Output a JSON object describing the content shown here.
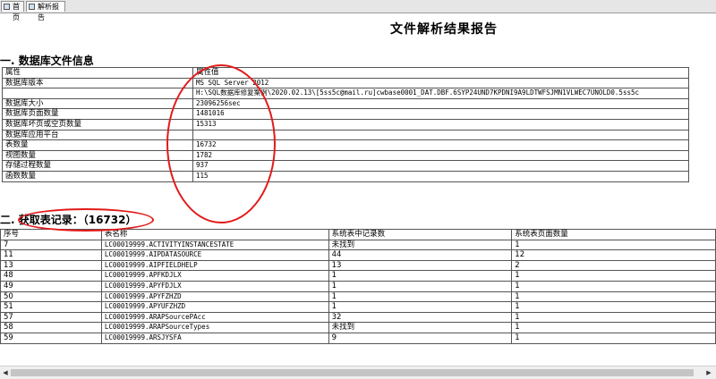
{
  "tabs": [
    {
      "label": "首页",
      "icon": "home-icon"
    },
    {
      "label": "解析报告",
      "icon": "report-icon"
    }
  ],
  "report_title": "文件解析结果报告",
  "section1": {
    "title": "一. 数据库文件信息",
    "header": [
      "属性",
      "属性值"
    ],
    "rows": [
      [
        "数据库版本",
        "MS SQL Server 2012"
      ],
      [
        "",
        "H:\\SQL数据库修复案例\\2020.02.13\\[5ss5c@mail.ru]cwbase0001_DAT.DBF.6SYP24UND7KPDNI9A9LDTWFSJMN1VLWEC7UNOLD0.5ss5c"
      ],
      [
        "数据库大小",
        "23096256sec"
      ],
      [
        "数据库页面数量",
        "1481016"
      ],
      [
        "数据库坏页或空页数量",
        "15313"
      ],
      [
        "数据库应用平台",
        ""
      ],
      [
        "表数量",
        "16732"
      ],
      [
        "视图数量",
        "1782"
      ],
      [
        "存储过程数量",
        "937"
      ],
      [
        "函数数量",
        "115"
      ]
    ]
  },
  "section2": {
    "title": "二. 获取表记录：（16732）",
    "header": [
      "序号",
      "表名称",
      "系统表中记录数",
      "系统表页面数量"
    ],
    "rows": [
      [
        "7",
        "LC00019999.ACTIVITYINSTANCESTATE",
        "未找到",
        "1"
      ],
      [
        "11",
        "LC00019999.AIPDATASOURCE",
        "44",
        "12"
      ],
      [
        "13",
        "LC00019999.AIPFIELDHELP",
        "13",
        "2"
      ],
      [
        "48",
        "LC00019999.APFKDJLX",
        "1",
        "1"
      ],
      [
        "49",
        "LC00019999.APYFDJLX",
        "1",
        "1"
      ],
      [
        "50",
        "LC00019999.APYFZHZD",
        "1",
        "1"
      ],
      [
        "51",
        "LC00019999.APYUFZHZD",
        "1",
        "1"
      ],
      [
        "57",
        "LC00019999.ARAPSourcePAcc",
        "32",
        "1"
      ],
      [
        "58",
        "LC00019999.ARAPSourceTypes",
        "未找到",
        "1"
      ],
      [
        "59",
        "LC00019999.ARSJYSFA",
        "9",
        "1"
      ]
    ]
  },
  "colors": {
    "annotation": "#e21a1a",
    "border": "#555555"
  }
}
